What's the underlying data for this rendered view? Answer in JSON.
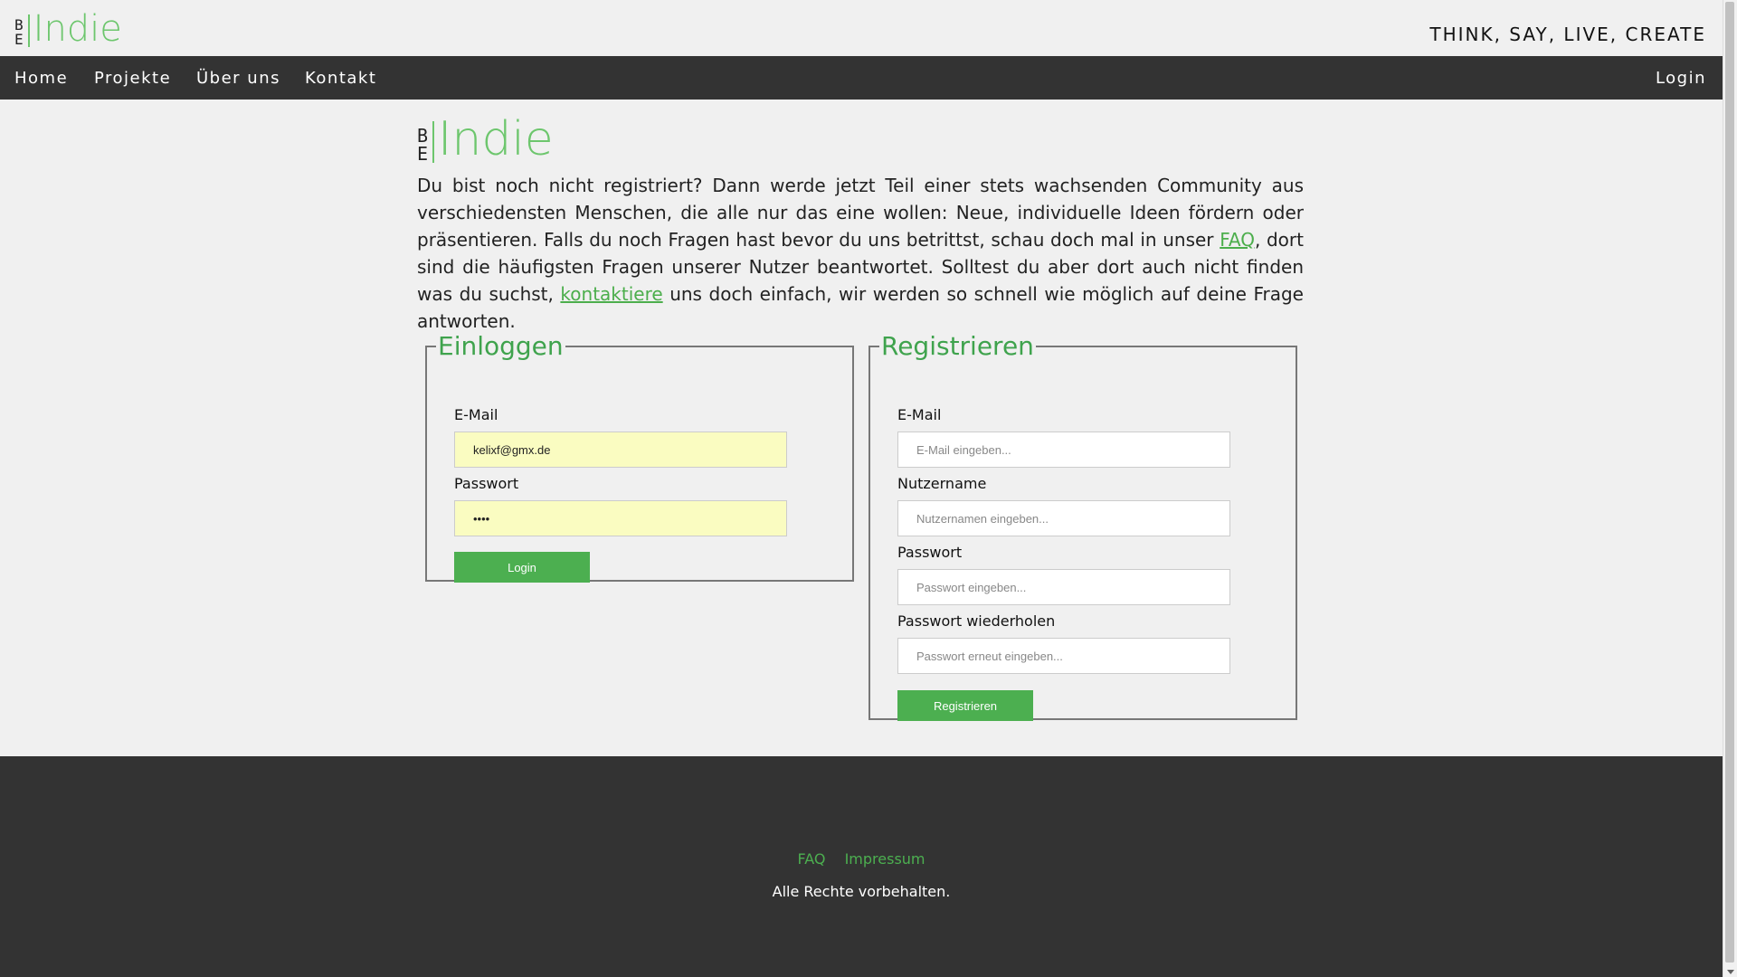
{
  "brand": {
    "be_line1": "B",
    "be_line2": "E",
    "word": "Indie",
    "accent": "#6dc66d"
  },
  "header": {
    "tagline": "THINK, SAY, LIVE, CREATE"
  },
  "nav": {
    "items": [
      {
        "label": "Home"
      },
      {
        "label": "Projekte"
      },
      {
        "label": "Über uns"
      },
      {
        "label": "Kontakt"
      }
    ],
    "login_label": "Login"
  },
  "intro": {
    "part1": "Du bist noch nicht registriert? Dann werde jetzt Teil einer stets wachsenden Community aus verschiedensten Menschen, die alle nur das eine wollen: Neue, individuelle Ideen fördern oder präsentieren. Falls du noch Fragen hast bevor du uns betrittst, schau doch mal in unser ",
    "faq_link": "FAQ",
    "part2": ", dort sind die häufigsten Fragen unserer Nutzer beantwortet. Solltest du aber dort auch nicht finden was du suchst, ",
    "contact_link": "kontaktiere",
    "part3": " uns doch einfach, wir werden so schnell wie möglich auf deine Frage antworten."
  },
  "login": {
    "legend": "Einloggen",
    "email_label": "E-Mail",
    "email_value": "kelixf@gmx.de",
    "password_label": "Passwort",
    "password_value": "••••",
    "button": "Login"
  },
  "register": {
    "legend": "Registrieren",
    "email_label": "E-Mail",
    "email_placeholder": "E-Mail eingeben...",
    "username_label": "Nutzername",
    "username_placeholder": "Nutzernamen eingeben...",
    "password_label": "Passwort",
    "password_placeholder": "Passwort eingeben...",
    "password_repeat_label": "Passwort wiederholen",
    "password_repeat_placeholder": "Passwort erneut eingeben...",
    "button": "Registrieren"
  },
  "footer": {
    "faq": "FAQ",
    "impressum": "Impressum",
    "rights": "Alle Rechte vorbehalten."
  }
}
